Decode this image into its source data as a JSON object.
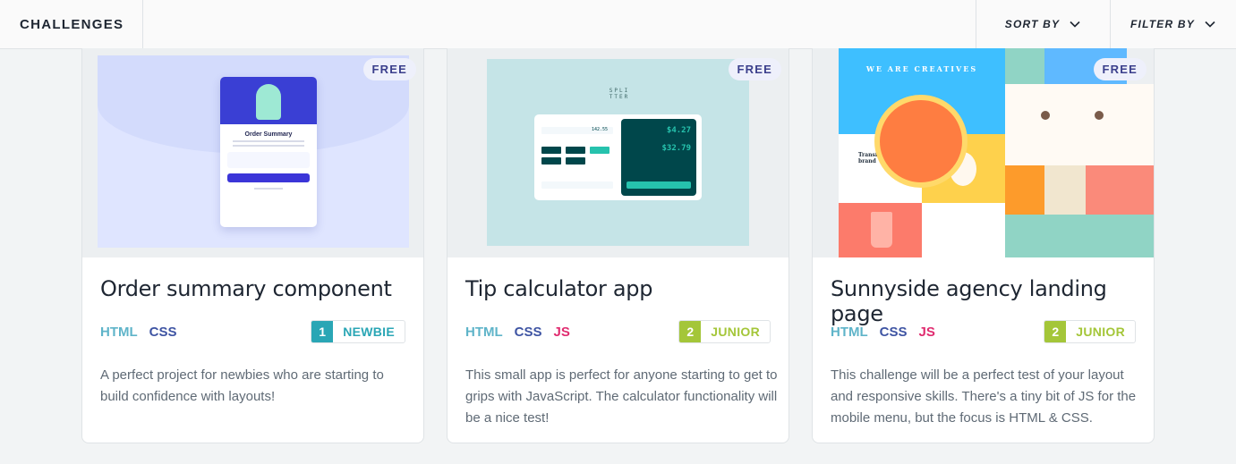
{
  "header": {
    "brand": "CHALLENGES",
    "sort_label": "SORT BY",
    "filter_label": "FILTER BY"
  },
  "cards": [
    {
      "badge": "FREE",
      "title": "Order summary component",
      "tags": [
        "HTML",
        "CSS"
      ],
      "level_num": "1",
      "level_label": "NEWBIE",
      "description": "A perfect project for newbies who are starting to build confidence with layouts!",
      "preview": {
        "title": "Order Summary"
      }
    },
    {
      "badge": "FREE",
      "title": "Tip calculator app",
      "tags": [
        "HTML",
        "CSS",
        "JS"
      ],
      "level_num": "2",
      "level_label": "JUNIOR",
      "description": "This small app is perfect for anyone starting to get to grips with JavaScript. The calculator functionality will be a nice test!",
      "preview": {
        "logo": "SPLI TTER",
        "tip_amount": "$4.27",
        "total": "$32.79",
        "bill": "142.55"
      }
    },
    {
      "badge": "FREE",
      "title": "Sunnyside agency landing page",
      "tags": [
        "HTML",
        "CSS",
        "JS"
      ],
      "level_num": "2",
      "level_label": "JUNIOR",
      "description": "This challenge will be a perfect test of your layout and responsive skills. There's a tiny bit of JS for the mobile menu, but the focus is HTML & CSS.",
      "preview": {
        "headline": "WE ARE CREATIVES",
        "subhead": "Transform your brand"
      }
    }
  ],
  "colors": {
    "html": "#5fb4c9",
    "css": "#3e54a3",
    "js": "#e02b6f",
    "newbie": "#2aa6b5",
    "junior": "#a4c639"
  }
}
